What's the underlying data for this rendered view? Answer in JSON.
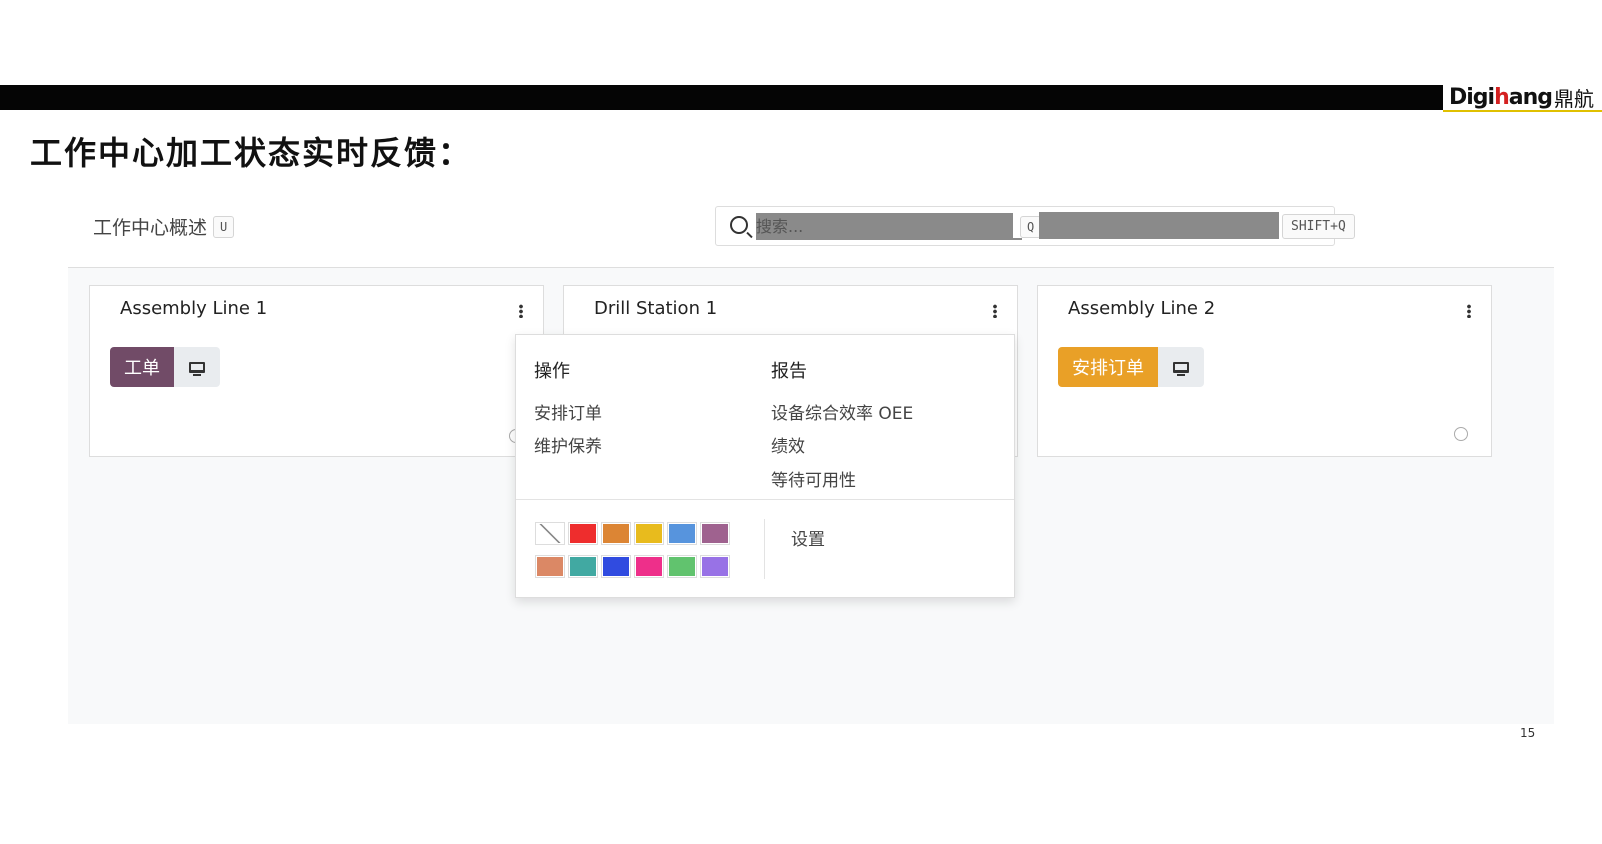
{
  "logo": {
    "en_prefix": "Digi",
    "en_highlight": "h",
    "en_suffix": "ang",
    "cn": "鼎航"
  },
  "slide_title": "工作中心加工状态实时反馈：",
  "app": {
    "title": "工作中心概述",
    "title_shortcut": "U"
  },
  "search": {
    "placeholder": "搜索...",
    "shortcut_q": "Q",
    "shortcut_shift": "SHIFT+Q"
  },
  "cards": [
    {
      "title": "Assembly Line 1",
      "button": "工单",
      "button_color": "#714b67"
    },
    {
      "title": "Drill Station 1"
    },
    {
      "title": "Assembly Line 2",
      "button": "安排订单",
      "button_color": "#e9a027"
    }
  ],
  "dropdown": {
    "actions_heading": "操作",
    "actions": [
      "安排订单",
      "维护保养"
    ],
    "reports_heading": "报告",
    "reports": [
      "设备综合效率 OEE",
      "绩效",
      "等待可用性"
    ],
    "settings": "设置",
    "colors": [
      "#ffffff",
      "#ee2d2d",
      "#dc8534",
      "#e8bb1d",
      "#5794dd",
      "#9f628f",
      "#db8865",
      "#41a9a2",
      "#304be0",
      "#ee2f8a",
      "#61c36e",
      "#9872e6"
    ]
  },
  "page_number": "15"
}
